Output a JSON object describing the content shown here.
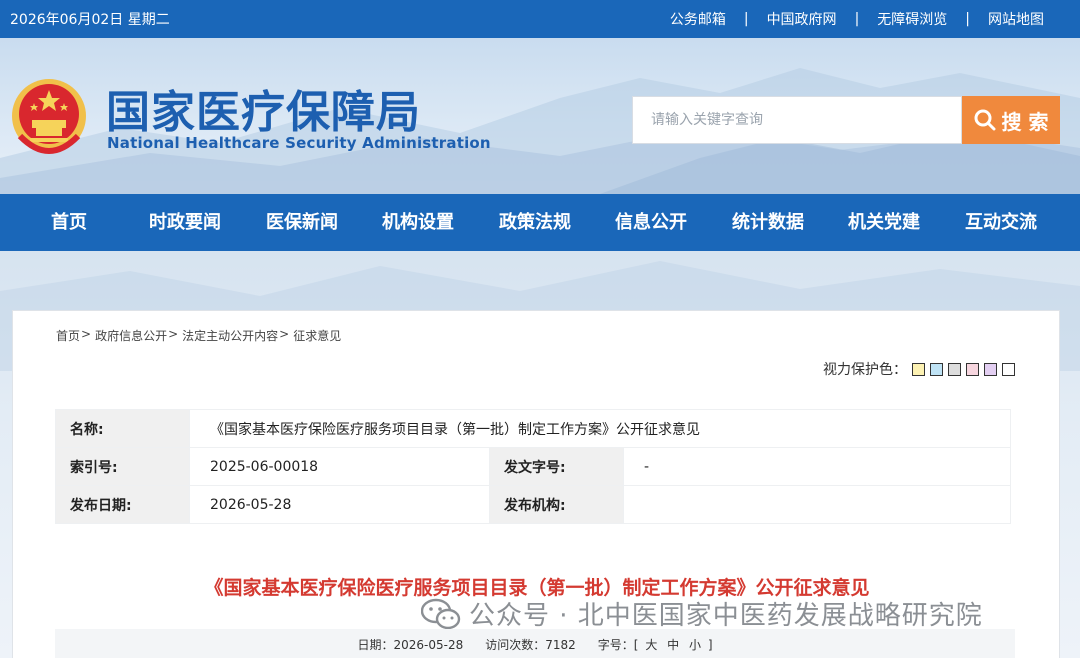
{
  "topbar": {
    "date": "2026年06月02日 星期二",
    "links": [
      "公务邮箱",
      "中国政府网",
      "无障碍浏览",
      "网站地图"
    ],
    "separator": "|"
  },
  "header": {
    "logo_cn": "国家医疗保障局",
    "logo_en": "National Healthcare Security Administration",
    "emblem_icon": "national-emblem-icon"
  },
  "search": {
    "placeholder": "请输入关键字查询",
    "button_label": "搜 索",
    "button_color": "#f0893d"
  },
  "nav": {
    "items": [
      "首页",
      "时政要闻",
      "医保新闻",
      "机构设置",
      "政策法规",
      "信息公开",
      "统计数据",
      "机关党建",
      "互动交流"
    ],
    "color": "#1a67b9"
  },
  "breadcrumb": {
    "items": [
      "首页",
      "政府信息公开",
      "法定主动公开内容",
      "征求意见"
    ],
    "separator": ">"
  },
  "eye_care": {
    "label": "视力保护色：",
    "swatches": [
      "#fdf2b3",
      "#bfe3f5",
      "#dddddd",
      "#f7d6df",
      "#e3cff2",
      "#ffffff"
    ]
  },
  "meta": {
    "name_label": "名称:",
    "name_value": "《国家基本医疗保险医疗服务项目目录（第一批）制定工作方案》公开征求意见",
    "index_label": "索引号:",
    "index_value": "2025-06-00018",
    "docno_label": "发文字号:",
    "docno_value": "-",
    "date_label": "发布日期:",
    "date_value": "2026-05-28",
    "org_label": "发布机构:",
    "org_value": ""
  },
  "doc_title": "《国家基本医疗保险医疗服务项目目录（第一批）制定工作方案》公开征求意见",
  "watermark": "公众号 · 北中医国家中医药发展战略研究院",
  "stats": {
    "date_label": "日期：",
    "date_value": "2026-05-28",
    "visits_label": "访问次数：",
    "visits_value": "7182",
    "font_label": "字号：",
    "font_open": "[",
    "font_large": "大",
    "font_medium": "中",
    "font_small": "小",
    "font_close": "]"
  },
  "colors": {
    "brand_blue": "#1a67b9",
    "title_red": "#d43a31"
  }
}
